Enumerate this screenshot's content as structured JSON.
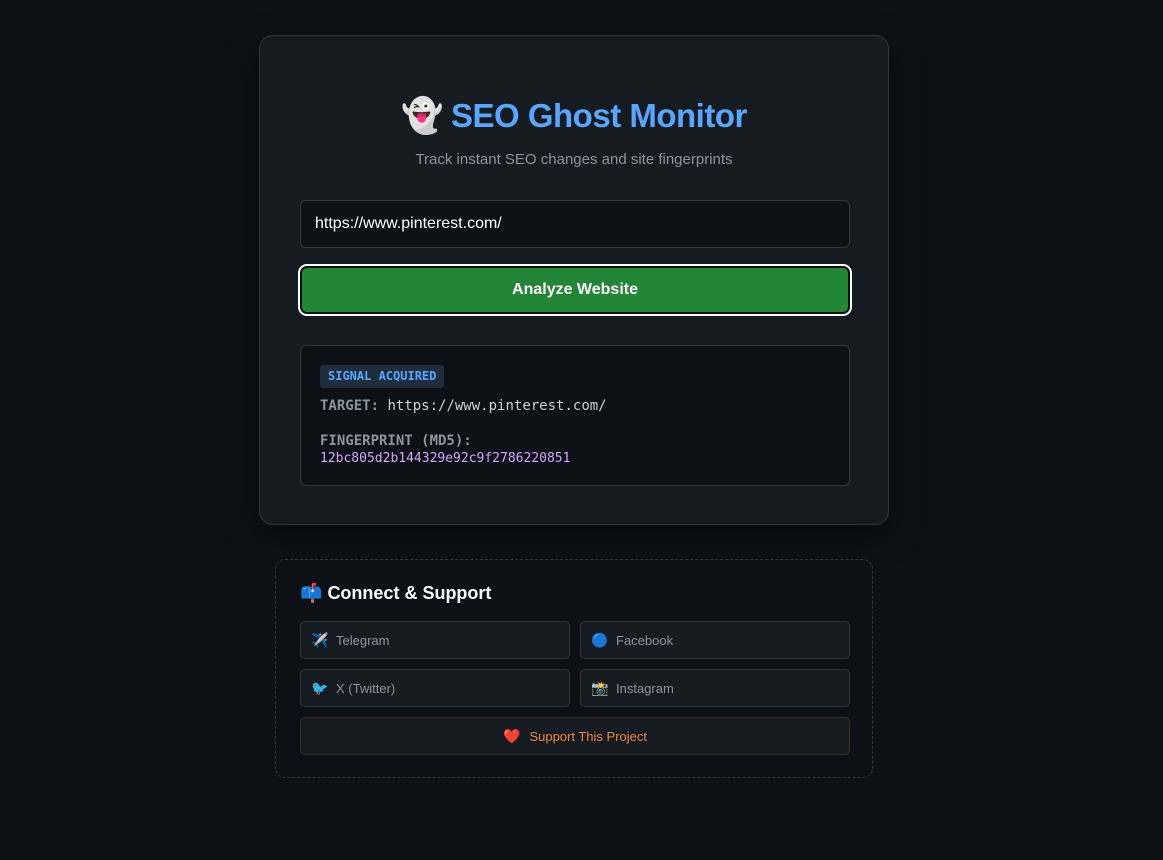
{
  "header": {
    "emoji": "👻",
    "title": "SEO Ghost Monitor",
    "subtitle": "Track instant SEO changes and site fingerprints"
  },
  "form": {
    "url_value": "https://www.pinterest.com/",
    "analyze_label": "Analyze Website"
  },
  "result": {
    "badge": "SIGNAL ACQUIRED",
    "target_label": "TARGET:",
    "target_value": "https://www.pinterest.com/",
    "fingerprint_label": "FINGERPRINT (MD5):",
    "fingerprint_value": "12bc805d2b144329e92c9f2786220851"
  },
  "support": {
    "emoji": "📫",
    "title": "Connect & Support",
    "links": [
      {
        "icon": "✈️",
        "label": "Telegram"
      },
      {
        "icon": "🔵",
        "label": "Facebook"
      },
      {
        "icon": "🐦",
        "label": "X (Twitter)"
      },
      {
        "icon": "📸",
        "label": "Instagram"
      }
    ],
    "donate": {
      "icon": "❤️",
      "label": "Support This Project"
    }
  },
  "colors": {
    "accent": "#58a6ff",
    "button_green": "#238636",
    "fingerprint": "#d2a8ff",
    "donate": "#f0883e",
    "background": "#0d1117"
  }
}
